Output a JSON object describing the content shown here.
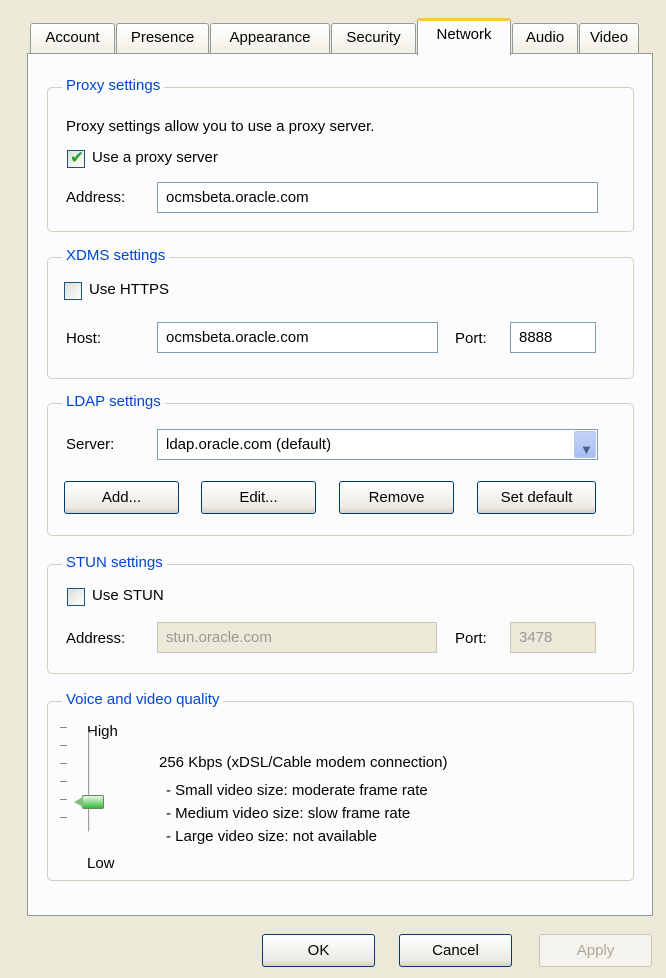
{
  "tabs": [
    {
      "label": "Account"
    },
    {
      "label": "Presence"
    },
    {
      "label": "Appearance"
    },
    {
      "label": "Security"
    },
    {
      "label": "Network",
      "active": true
    },
    {
      "label": "Audio"
    },
    {
      "label": "Video"
    }
  ],
  "proxy": {
    "title": "Proxy settings",
    "description": "Proxy settings allow you to use a proxy server.",
    "use_proxy_label": "Use a proxy server",
    "use_proxy_checked": true,
    "address_label": "Address:",
    "address_value": "ocmsbeta.oracle.com"
  },
  "xdms": {
    "title": "XDMS settings",
    "use_https_label": "Use HTTPS",
    "use_https_checked": false,
    "host_label": "Host:",
    "host_value": "ocmsbeta.oracle.com",
    "port_label": "Port:",
    "port_value": "8888"
  },
  "ldap": {
    "title": "LDAP settings",
    "server_label": "Server:",
    "server_value": "ldap.oracle.com (default)",
    "add_label": "Add...",
    "edit_label": "Edit...",
    "remove_label": "Remove",
    "set_default_label": "Set default"
  },
  "stun": {
    "title": "STUN settings",
    "use_stun_label": "Use STUN",
    "use_stun_checked": false,
    "address_label": "Address:",
    "address_value": "stun.oracle.com",
    "port_label": "Port:",
    "port_value": "3478"
  },
  "quality": {
    "title": "Voice and video quality",
    "high_label": "High",
    "low_label": "Low",
    "level_fraction": 0.4,
    "bitrate": "256 Kbps (xDSL/Cable modem connection)",
    "small_video": "- Small video size: moderate frame rate",
    "medium_video": "- Medium video size: slow frame rate",
    "large_video": "- Large video size: not available"
  },
  "footer": {
    "ok_label": "OK",
    "cancel_label": "Cancel",
    "apply_label": "Apply"
  },
  "colors": {
    "group_title": "#0046d5",
    "active_tab_accent": "#ffc83c",
    "window_bg": "#ece9d8"
  }
}
